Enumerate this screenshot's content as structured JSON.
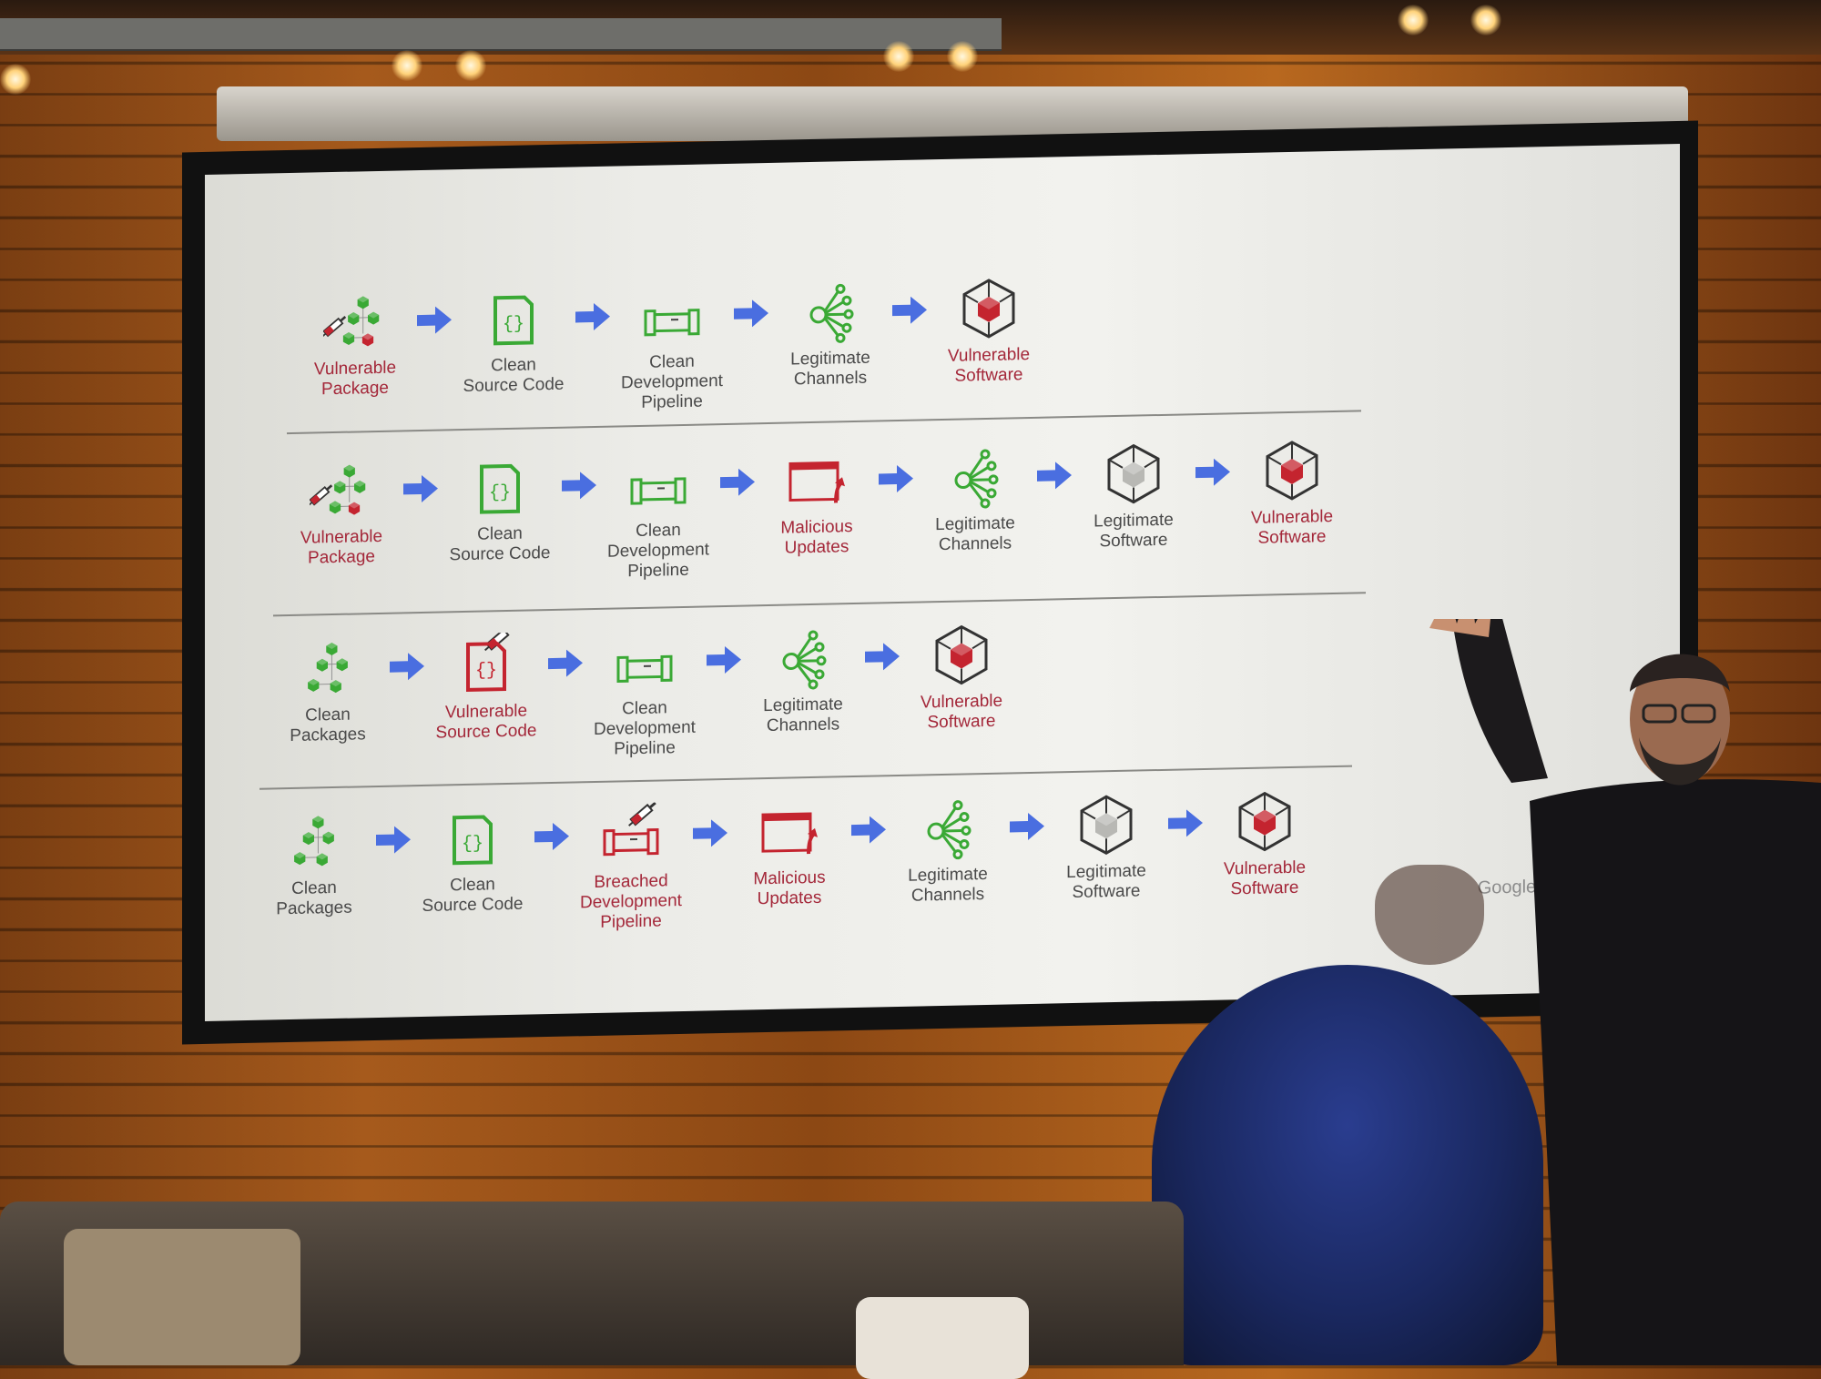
{
  "scene": {
    "description": "Presenter in front of a projected slide showing software supply chain attack paths",
    "brand_text": "Google Cloud"
  },
  "colors": {
    "clean_green": "#3aa935",
    "vulnerable_red": "#c4242f",
    "label_red": "#a4283a",
    "label_gray": "#4a4a4a",
    "arrow_blue": "#4a6ee0",
    "neutral_gray": "#b8b8b4"
  },
  "slide": {
    "rows": [
      {
        "steps": [
          {
            "icon": "vulnerable-package-icon",
            "label": "Vulnerable\nPackage",
            "status": "bad"
          },
          {
            "icon": "source-code-icon",
            "label": "Clean\nSource Code",
            "status": "clean"
          },
          {
            "icon": "pipeline-icon",
            "label": "Clean\nDevelopment\nPipeline",
            "status": "clean"
          },
          {
            "icon": "channels-icon",
            "label": "Legitimate\nChannels",
            "status": "clean"
          },
          {
            "icon": "software-box-icon",
            "label": "Vulnerable\nSoftware",
            "status": "bad"
          }
        ]
      },
      {
        "steps": [
          {
            "icon": "vulnerable-package-icon",
            "label": "Vulnerable\nPackage",
            "status": "bad"
          },
          {
            "icon": "source-code-icon",
            "label": "Clean\nSource Code",
            "status": "clean"
          },
          {
            "icon": "pipeline-icon",
            "label": "Clean\nDevelopment\nPipeline",
            "status": "clean"
          },
          {
            "icon": "malicious-update-icon",
            "label": "Malicious\nUpdates",
            "status": "bad"
          },
          {
            "icon": "channels-icon",
            "label": "Legitimate\nChannels",
            "status": "clean"
          },
          {
            "icon": "software-box-icon",
            "label": "Legitimate\nSoftware",
            "status": "neutral"
          },
          {
            "icon": "software-box-icon",
            "label": "Vulnerable\nSoftware",
            "status": "bad"
          }
        ]
      },
      {
        "steps": [
          {
            "icon": "clean-packages-icon",
            "label": "Clean\nPackages",
            "status": "clean"
          },
          {
            "icon": "source-code-icon",
            "label": "Vulnerable\nSource Code",
            "status": "bad"
          },
          {
            "icon": "pipeline-icon",
            "label": "Clean\nDevelopment\nPipeline",
            "status": "clean"
          },
          {
            "icon": "channels-icon",
            "label": "Legitimate\nChannels",
            "status": "clean"
          },
          {
            "icon": "software-box-icon",
            "label": "Vulnerable\nSoftware",
            "status": "bad"
          }
        ]
      },
      {
        "steps": [
          {
            "icon": "clean-packages-icon",
            "label": "Clean\nPackages",
            "status": "clean"
          },
          {
            "icon": "source-code-icon",
            "label": "Clean\nSource Code",
            "status": "clean"
          },
          {
            "icon": "pipeline-icon",
            "label": "Breached\nDevelopment\nPipeline",
            "status": "bad"
          },
          {
            "icon": "malicious-update-icon",
            "label": "Malicious\nUpdates",
            "status": "bad"
          },
          {
            "icon": "channels-icon",
            "label": "Legitimate\nChannels",
            "status": "clean"
          },
          {
            "icon": "software-box-icon",
            "label": "Legitimate\nSoftware",
            "status": "neutral"
          },
          {
            "icon": "software-box-icon",
            "label": "Vulnerable\nSoftware",
            "status": "bad"
          }
        ]
      }
    ]
  }
}
